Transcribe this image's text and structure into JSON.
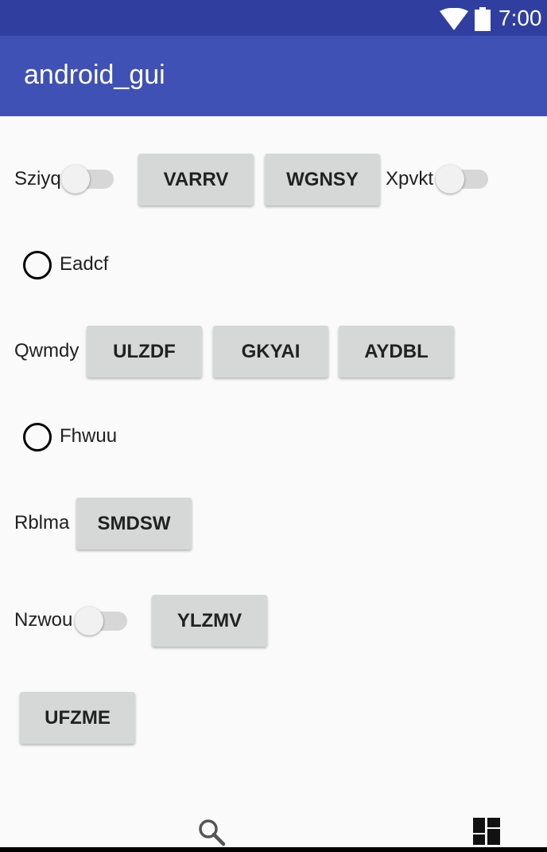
{
  "status_bar": {
    "time": "7:00",
    "icons": [
      "wifi-icon",
      "battery-icon"
    ]
  },
  "app_bar": {
    "title": "android_gui"
  },
  "rows": {
    "row1": {
      "switch1_label": "Sziyq",
      "button1": "VARRV",
      "button2": "WGNSY",
      "switch2_label": "Xpvkt"
    },
    "row2": {
      "radio_label": "Eadcf"
    },
    "row3": {
      "label": "Qwmdy",
      "button1": "ULZDF",
      "button2": "GKYAI",
      "button3": "AYDBL"
    },
    "row4": {
      "radio_label": "Fhwuu"
    },
    "row5": {
      "label": "Rblma",
      "button1": "SMDSW"
    },
    "row6": {
      "switch_label": "Nzwou",
      "button1": "YLZMV"
    },
    "row7": {
      "button1": "UFZME"
    }
  },
  "nav_bar": {
    "icons": [
      "search-icon",
      "dashboard-icon"
    ]
  },
  "colors": {
    "status_bar": "#303f9f",
    "app_bar": "#3f51b5",
    "button": "#d6d7d7",
    "background": "#fafafa"
  }
}
